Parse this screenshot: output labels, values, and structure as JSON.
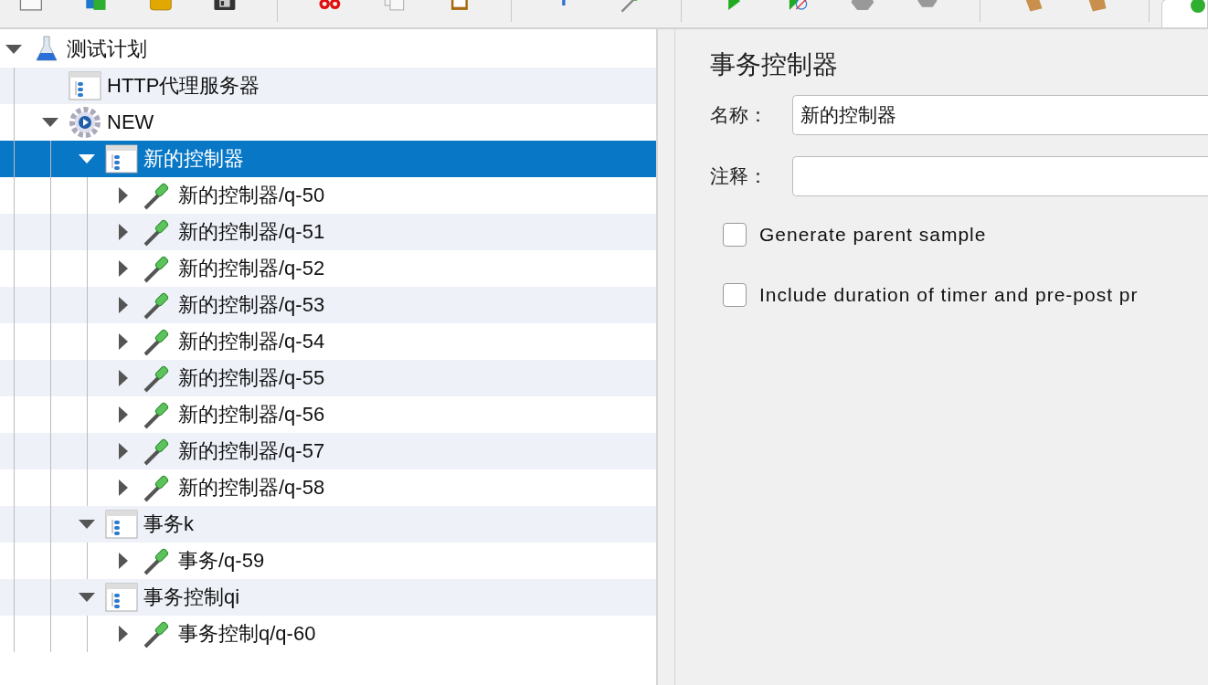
{
  "toolbar": {
    "items": [
      {
        "kind": "blank"
      },
      {
        "kind": "templates"
      },
      {
        "kind": "open"
      },
      {
        "kind": "save"
      },
      {
        "kind": "separator"
      },
      {
        "kind": "cut"
      },
      {
        "kind": "copy"
      },
      {
        "kind": "paste"
      },
      {
        "kind": "separator"
      },
      {
        "kind": "expand"
      },
      {
        "kind": "toggle"
      },
      {
        "kind": "separator"
      },
      {
        "kind": "start"
      },
      {
        "kind": "start-no-pause"
      },
      {
        "kind": "stop"
      },
      {
        "kind": "shutdown"
      },
      {
        "kind": "separator"
      },
      {
        "kind": "clear"
      },
      {
        "kind": "clear-all"
      },
      {
        "kind": "separator"
      },
      {
        "kind": "tab"
      }
    ]
  },
  "tree": {
    "items": [
      {
        "label": "测试计划",
        "kind": "plan",
        "expanded": true,
        "selected": false,
        "children": [
          {
            "label": "HTTP代理服务器",
            "kind": "controller",
            "selected": false
          },
          {
            "label": "NEW",
            "kind": "gear",
            "expanded": true,
            "selected": false,
            "children": [
              {
                "label": "新的控制器",
                "kind": "controller",
                "expanded": true,
                "selected": true,
                "children": [
                  {
                    "label": "新的控制器/q-50",
                    "kind": "sampler",
                    "expanded": false,
                    "selected": false
                  },
                  {
                    "label": "新的控制器/q-51",
                    "kind": "sampler",
                    "expanded": false,
                    "selected": false
                  },
                  {
                    "label": "新的控制器/q-52",
                    "kind": "sampler",
                    "expanded": false,
                    "selected": false
                  },
                  {
                    "label": "新的控制器/q-53",
                    "kind": "sampler",
                    "expanded": false,
                    "selected": false
                  },
                  {
                    "label": "新的控制器/q-54",
                    "kind": "sampler",
                    "expanded": false,
                    "selected": false
                  },
                  {
                    "label": "新的控制器/q-55",
                    "kind": "sampler",
                    "expanded": false,
                    "selected": false
                  },
                  {
                    "label": "新的控制器/q-56",
                    "kind": "sampler",
                    "expanded": false,
                    "selected": false
                  },
                  {
                    "label": "新的控制器/q-57",
                    "kind": "sampler",
                    "expanded": false,
                    "selected": false
                  },
                  {
                    "label": "新的控制器/q-58",
                    "kind": "sampler",
                    "expanded": false,
                    "selected": false
                  }
                ]
              },
              {
                "label": "事务k",
                "kind": "controller",
                "expanded": true,
                "selected": false,
                "children": [
                  {
                    "label": "事务/q-59",
                    "kind": "sampler",
                    "expanded": false,
                    "selected": false
                  }
                ]
              },
              {
                "label": "事务控制qi",
                "kind": "controller",
                "expanded": true,
                "selected": false,
                "children": [
                  {
                    "label": "事务控制q/q-60",
                    "kind": "sampler",
                    "expanded": false,
                    "selected": false
                  }
                ]
              }
            ]
          }
        ]
      }
    ]
  },
  "panel": {
    "title": "事务控制器",
    "fields": [
      {
        "label": "名称：",
        "value": "新的控制器"
      },
      {
        "label": "注释："
      }
    ],
    "checkboxes": [
      {
        "label": "Generate parent sample",
        "checked": false
      },
      {
        "label": "Include duration of timer and pre-post pr",
        "checked": false
      }
    ]
  }
}
